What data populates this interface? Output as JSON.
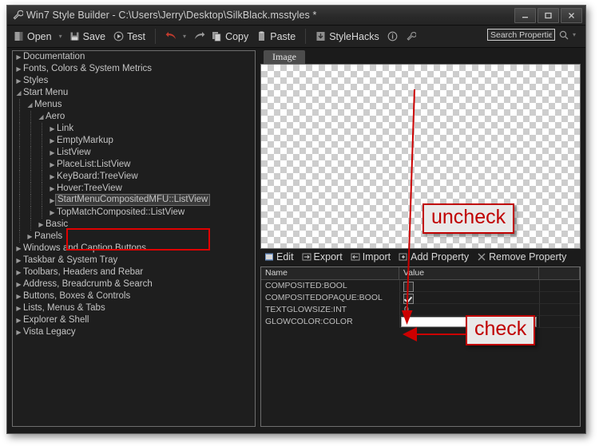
{
  "window": {
    "title": "Win7 Style Builder - C:\\Users\\Jerry\\Desktop\\SilkBlack.msstyles *",
    "icon": "wrench-icon",
    "controls": [
      {
        "name": "minimize-button",
        "glyph": "—"
      },
      {
        "name": "maximize-button",
        "glyph": "▢"
      },
      {
        "name": "close-button",
        "glyph": "✕"
      }
    ]
  },
  "toolbar": {
    "items": [
      {
        "name": "open-button",
        "label": "Open",
        "icon": "folder-icon",
        "caret": true
      },
      {
        "name": "save-button",
        "label": "Save",
        "icon": "floppy-icon",
        "caret": false
      },
      {
        "name": "test-button",
        "label": "Test",
        "icon": "play-icon",
        "caret": false
      },
      {
        "name": "undo-button",
        "label": "",
        "icon": "undo-arrow-icon",
        "caret": true
      },
      {
        "name": "redo-button",
        "label": "",
        "icon": "redo-arrow-icon",
        "caret": false
      },
      {
        "name": "copy-button",
        "label": "Copy",
        "icon": "copy-icon",
        "caret": false
      },
      {
        "name": "paste-button",
        "label": "Paste",
        "icon": "paste-icon",
        "caret": false
      },
      {
        "name": "stylehacks-button",
        "label": "StyleHacks",
        "icon": "download-icon",
        "caret": false
      },
      {
        "name": "info-button",
        "label": "",
        "icon": "info-circle-icon",
        "caret": false
      },
      {
        "name": "settings-button",
        "label": "",
        "icon": "wrench-icon",
        "caret": false
      }
    ],
    "search": {
      "name": "search-properties-input",
      "placeholder": "Search Properties",
      "value": "",
      "icon": "magnifier-icon",
      "caret": "▾"
    }
  },
  "tree": {
    "items": [
      {
        "label": "Documentation",
        "depth": 0,
        "state": "collapsed",
        "selected": false
      },
      {
        "label": "Fonts, Colors & System Metrics",
        "depth": 0,
        "state": "collapsed",
        "selected": false
      },
      {
        "label": "Styles",
        "depth": 0,
        "state": "collapsed",
        "selected": false
      },
      {
        "label": "Start Menu",
        "depth": 0,
        "state": "expanded",
        "selected": false
      },
      {
        "label": "Menus",
        "depth": 1,
        "state": "expanded",
        "selected": false
      },
      {
        "label": "Aero",
        "depth": 2,
        "state": "expanded",
        "selected": false
      },
      {
        "label": "Link",
        "depth": 3,
        "state": "collapsed",
        "selected": false
      },
      {
        "label": "EmptyMarkup",
        "depth": 3,
        "state": "collapsed",
        "selected": false
      },
      {
        "label": "ListView",
        "depth": 3,
        "state": "collapsed",
        "selected": false
      },
      {
        "label": "PlaceList:ListView",
        "depth": 3,
        "state": "collapsed",
        "selected": false
      },
      {
        "label": "KeyBoard:TreeView",
        "depth": 3,
        "state": "collapsed",
        "selected": false
      },
      {
        "label": "Hover:TreeView",
        "depth": 3,
        "state": "collapsed",
        "selected": false
      },
      {
        "label": "StartMenuCompositedMFU::ListView",
        "depth": 3,
        "state": "collapsed",
        "selected": true
      },
      {
        "label": "TopMatchComposited::ListView",
        "depth": 3,
        "state": "collapsed",
        "selected": false
      },
      {
        "label": "Basic",
        "depth": 2,
        "state": "collapsed",
        "selected": false
      },
      {
        "label": "Panels",
        "depth": 1,
        "state": "collapsed",
        "selected": false
      },
      {
        "label": "Windows and Caption Buttons",
        "depth": 0,
        "state": "collapsed",
        "selected": false
      },
      {
        "label": "Taskbar & System Tray",
        "depth": 0,
        "state": "collapsed",
        "selected": false
      },
      {
        "label": "Toolbars, Headers and Rebar",
        "depth": 0,
        "state": "collapsed",
        "selected": false
      },
      {
        "label": "Address, Breadcrumb & Search",
        "depth": 0,
        "state": "collapsed",
        "selected": false
      },
      {
        "label": "Buttons, Boxes & Controls",
        "depth": 0,
        "state": "collapsed",
        "selected": false
      },
      {
        "label": "Lists, Menus & Tabs",
        "depth": 0,
        "state": "collapsed",
        "selected": false
      },
      {
        "label": "Explorer & Shell",
        "depth": 0,
        "state": "collapsed",
        "selected": false
      },
      {
        "label": "Vista Legacy",
        "depth": 0,
        "state": "collapsed",
        "selected": false
      }
    ]
  },
  "preview": {
    "tab_label": "Image",
    "background": "transparent-checkerboard"
  },
  "property_toolbar": {
    "items": [
      {
        "name": "edit-button",
        "label": "Edit",
        "icon": "edit-icon"
      },
      {
        "name": "export-button",
        "label": "Export",
        "icon": "export-icon"
      },
      {
        "name": "import-button",
        "label": "Import",
        "icon": "import-icon"
      },
      {
        "name": "add-property-button",
        "label": "Add Property",
        "icon": "add-icon"
      },
      {
        "name": "remove-property-button",
        "label": "Remove Property",
        "icon": "remove-x-icon"
      }
    ]
  },
  "property_grid": {
    "columns": [
      "Name",
      "Value",
      ""
    ],
    "rows": [
      {
        "name": "COMPOSITED:BOOL",
        "type": "checkbox",
        "value": false,
        "text": ""
      },
      {
        "name": "COMPOSITEDOPAQUE:BOOL",
        "type": "checkbox",
        "value": true,
        "text": ""
      },
      {
        "name": "TEXTGLOWSIZE:INT",
        "type": "text",
        "value": null,
        "text": "0"
      },
      {
        "name": "GLOWCOLOR:COLOR",
        "type": "color",
        "value": "#ffffff",
        "text": ""
      }
    ]
  },
  "annotations": {
    "uncheck": {
      "label": "uncheck",
      "color": "#c00000",
      "target": "COMPOSITED:BOOL checkbox"
    },
    "check": {
      "label": "check",
      "color": "#c00000",
      "target": "COMPOSITEDOPAQUE:BOOL checkbox"
    },
    "tree_highlight_color": "#e00000"
  }
}
